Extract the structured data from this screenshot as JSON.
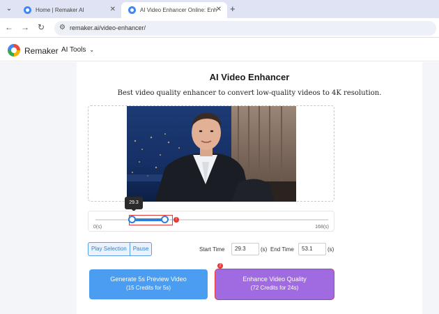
{
  "browser": {
    "tabs": [
      {
        "title": "Home | Remaker AI",
        "active": false
      },
      {
        "title": "AI Video Enhancer Online: Enh",
        "active": true
      }
    ],
    "new_tab": "+",
    "url": "remaker.ai/video-enhancer/"
  },
  "header": {
    "brand": "Remaker",
    "menu": "AI Tools"
  },
  "main": {
    "title": "AI Video Enhancer",
    "subtitle": "Best video quality enhancer to convert low-quality videos to 4K resolution.",
    "timeline": {
      "start_label": "0(s)",
      "end_label": "168(s)",
      "tooltip": "29.3",
      "warn_badge": "!"
    },
    "segment": {
      "play_selection": "Play Selection",
      "pause": "Pause"
    },
    "start_time_label": "Start Time",
    "start_time_value": "29.3",
    "start_unit": "(s)",
    "end_time_label": "End Time",
    "end_time_value": "53.1",
    "end_unit": "(s)",
    "preview_button": {
      "line1": "Generate 5s Preview Video",
      "line2": "(15 Credits for 5s)"
    },
    "enhance_button": {
      "line1": "Enhance Video Quality",
      "line2": "(72 Credits for 24s)",
      "badge": "2"
    }
  },
  "colors": {
    "accent_blue": "#4a9df0",
    "accent_purple": "#a06be0",
    "error_red": "#e53935"
  }
}
